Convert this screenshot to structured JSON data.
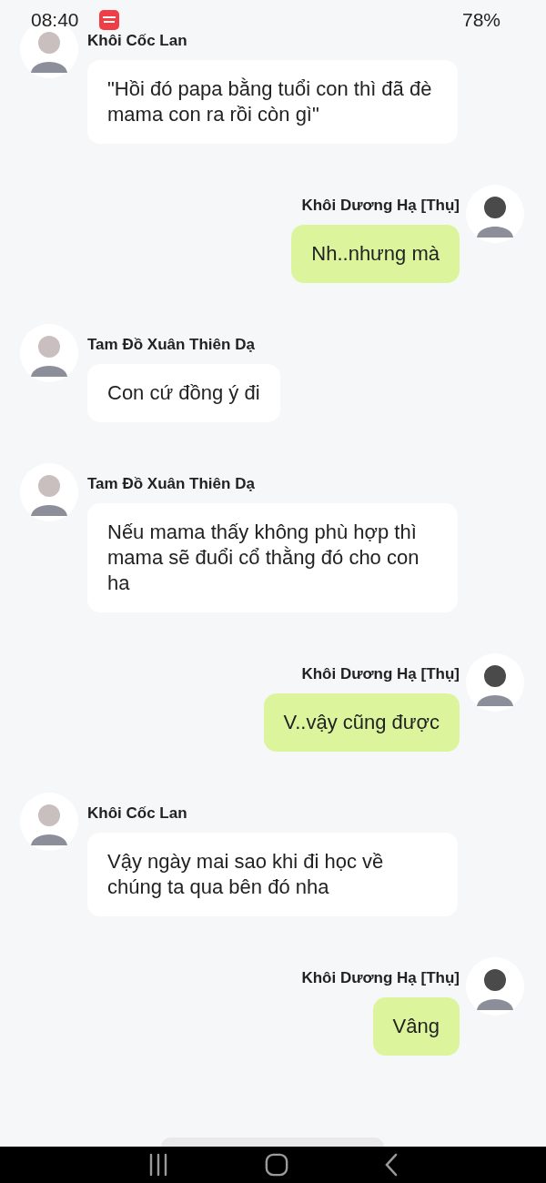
{
  "status_bar": {
    "time": "08:40",
    "battery": "78%"
  },
  "messages": [
    {
      "kind": "incoming",
      "sender": "Khôi Cốc Lan",
      "text": "\"Hồi đó papa bằng tuổi con thì đã đè mama con ra rồi còn gì\""
    },
    {
      "kind": "outgoing",
      "sender": "Khôi Dương Hạ [Thụ]",
      "text": "Nh..nhưng mà"
    },
    {
      "kind": "incoming",
      "sender": "Tam Đồ Xuân Thiên Dạ",
      "text": "Con cứ đồng ý đi"
    },
    {
      "kind": "incoming",
      "sender": "Tam Đồ Xuân Thiên Dạ",
      "text": "Nếu mama thấy không phù hợp thì mama sẽ đuổi cổ thằng đó cho con ha"
    },
    {
      "kind": "outgoing",
      "sender": "Khôi Dương Hạ [Thụ]",
      "text": "V..vậy cũng được"
    },
    {
      "kind": "incoming",
      "sender": "Khôi Cốc Lan",
      "text": "Vậy ngày mai sao khi đi học về chúng ta qua bên đó nha"
    },
    {
      "kind": "outgoing",
      "sender": "Khôi Dương Hạ [Thụ]",
      "text": "Vâng"
    }
  ]
}
